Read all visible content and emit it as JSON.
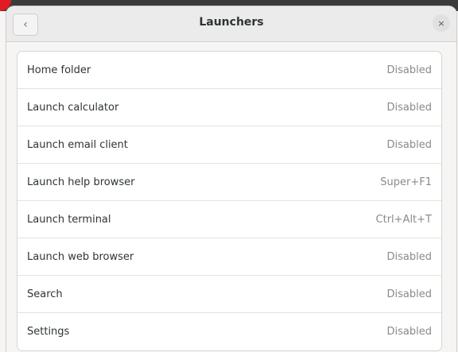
{
  "header": {
    "title": "Launchers",
    "back_glyph": "‹",
    "back_icon": "chevron-left-icon",
    "close_glyph": "×",
    "close_icon": "close-icon"
  },
  "shortcuts": [
    {
      "label": "Home folder",
      "value": "Disabled"
    },
    {
      "label": "Launch calculator",
      "value": "Disabled"
    },
    {
      "label": "Launch email client",
      "value": "Disabled"
    },
    {
      "label": "Launch help browser",
      "value": "Super+F1"
    },
    {
      "label": "Launch terminal",
      "value": "Ctrl+Alt+T"
    },
    {
      "label": "Launch web browser",
      "value": "Disabled"
    },
    {
      "label": "Search",
      "value": "Disabled"
    },
    {
      "label": "Settings",
      "value": "Disabled"
    }
  ],
  "colors": {
    "accent": "#e01b24",
    "text": "#2e3436",
    "muted": "#8a8a8a"
  }
}
